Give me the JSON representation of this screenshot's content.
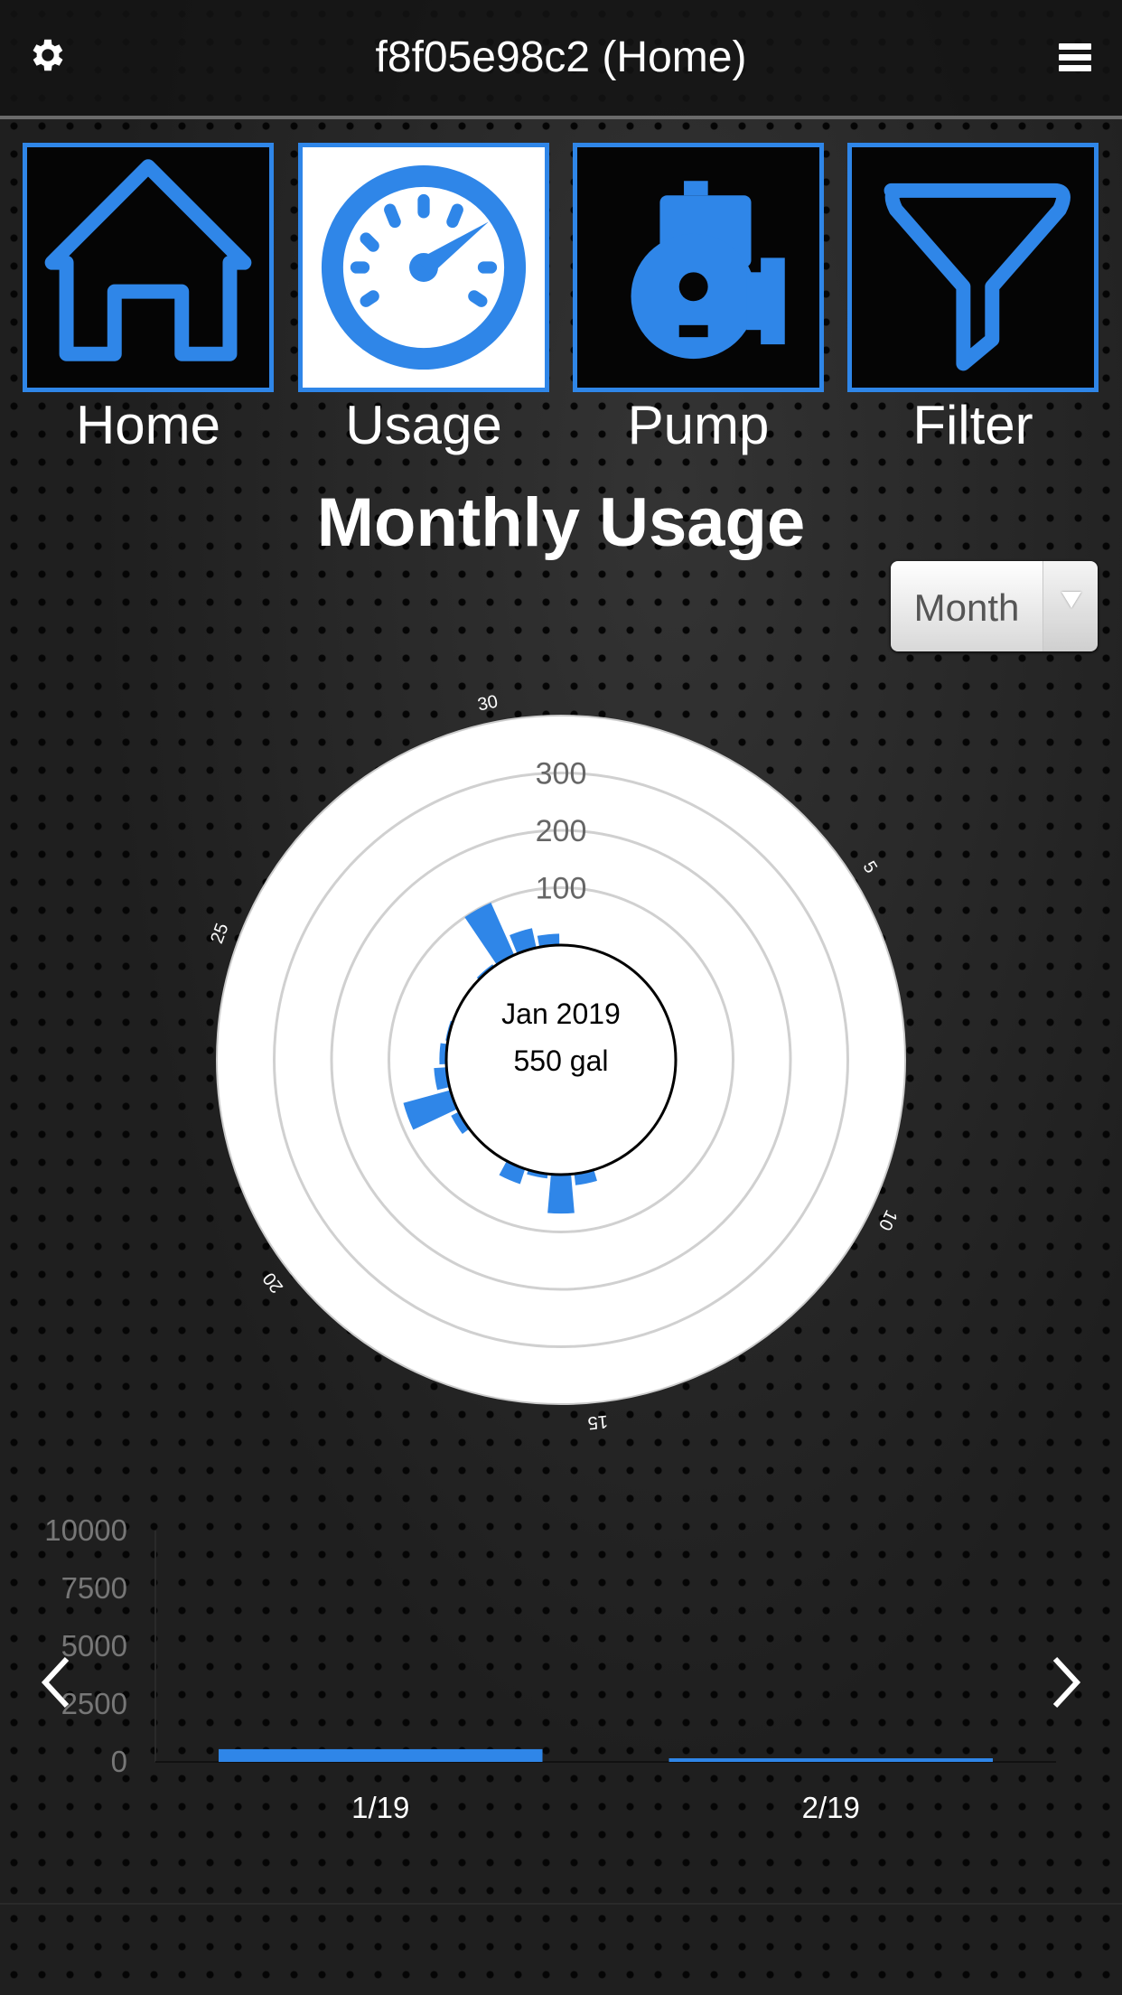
{
  "header": {
    "title": "f8f05e98c2 (Home)",
    "settings_icon": "gear-icon",
    "menu_icon": "hamburger-icon"
  },
  "tiles": [
    {
      "label": "Home",
      "icon": "house-icon",
      "active": false
    },
    {
      "label": "Usage",
      "icon": "gauge-icon",
      "active": true
    },
    {
      "label": "Pump",
      "icon": "pump-icon",
      "active": false
    },
    {
      "label": "Filter",
      "icon": "funnel-icon",
      "active": false
    }
  ],
  "page_title": "Monthly Usage",
  "period_select": {
    "selected": "Month"
  },
  "colors": {
    "accent": "#2f86e8",
    "background": "#1f1f1f"
  },
  "chart_data": [
    {
      "type": "polar-bar",
      "center_label": "Jan 2019",
      "center_value": "550 gal",
      "days_in_month": 31,
      "angular_ticks": [
        "5",
        "10",
        "15",
        "20",
        "25",
        "30"
      ],
      "radial_ticks": [
        "100",
        "200",
        "300"
      ],
      "rlim": [
        0,
        400
      ],
      "days": [
        15,
        16,
        17,
        18,
        21,
        22,
        23,
        24,
        25,
        28,
        29,
        30,
        31
      ],
      "values": [
        20,
        68,
        8,
        28,
        15,
        85,
        22,
        12,
        4,
        5,
        100,
        35,
        20
      ]
    },
    {
      "type": "bar",
      "categories": [
        "1/19",
        "2/19"
      ],
      "values": [
        550,
        100
      ],
      "yticks": [
        "0",
        "2500",
        "5000",
        "7500",
        "10000"
      ],
      "ylim": [
        0,
        10000
      ]
    }
  ],
  "nav": {
    "prev_icon": "chevron-left-icon",
    "next_icon": "chevron-right-icon"
  }
}
